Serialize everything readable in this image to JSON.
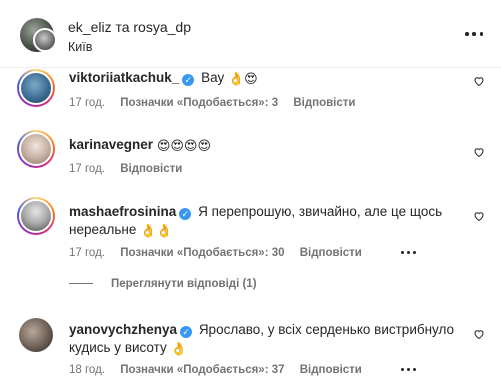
{
  "header": {
    "title": "ek_eliz та rosya_dp",
    "location": "Київ"
  },
  "comments": [
    {
      "username": "viktoriiatkachuk_",
      "verified": true,
      "text": "Вау",
      "emoji": "👌😍",
      "time": "17 год.",
      "likes": "Позначки «Подобається»: 3",
      "reply": "Відповісти"
    },
    {
      "username": "karinavegner",
      "verified": false,
      "text": "",
      "emoji": "😍😍😍😍",
      "time": "17 год.",
      "likes": "",
      "reply": "Відповісти"
    },
    {
      "username": "mashaefrosinina",
      "verified": true,
      "text": "Я перепрошую, звичайно, але це щось нереальне",
      "emoji": "👌👌",
      "time": "17 год.",
      "likes": "Позначки «Подобається»: 30",
      "reply": "Відповісти"
    },
    {
      "username": "yanovychzhenya",
      "verified": true,
      "text": "Ярославо, у всіх серденько вистрибнуло кудись у висоту",
      "emoji": "👌",
      "time": "18 год.",
      "likes": "Позначки «Подобається»: 37",
      "reply": "Відповісти"
    }
  ],
  "view_replies": "Переглянути відповіді (1)",
  "colors": {
    "verified": "#3897f0",
    "muted": "#737373",
    "text": "#262626"
  }
}
